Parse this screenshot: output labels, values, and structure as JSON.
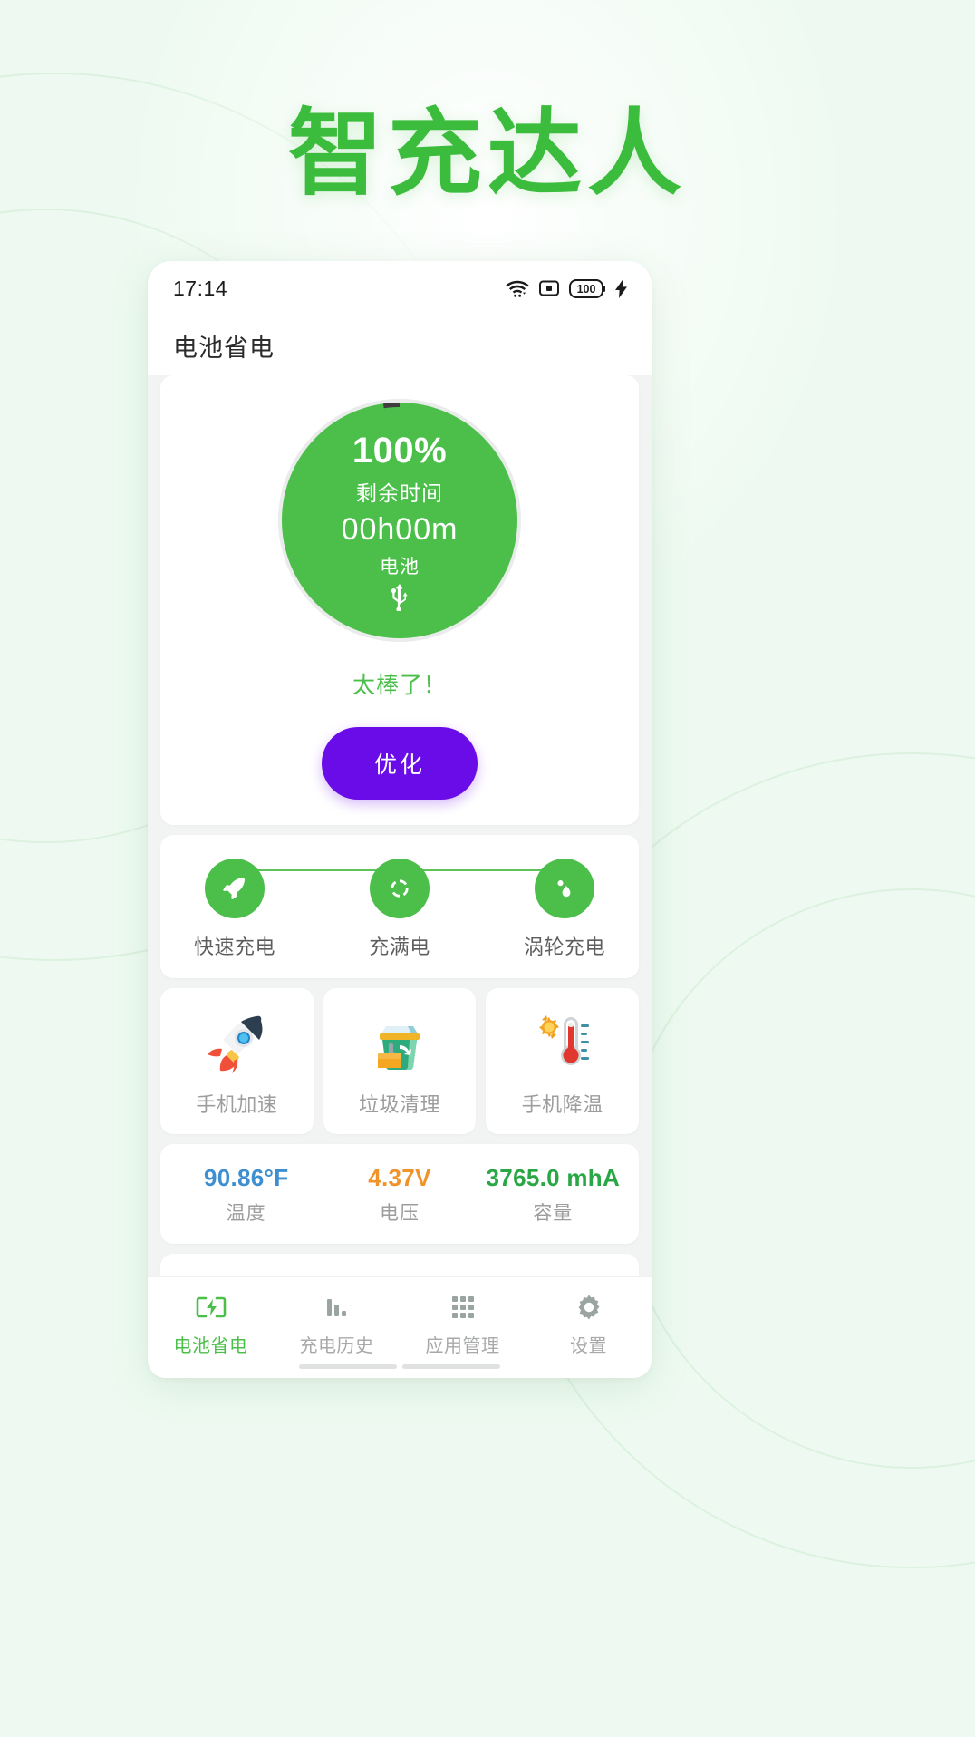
{
  "brand": {
    "title": "智充达人",
    "color": "#3cbc3c"
  },
  "statusbar": {
    "time": "17:14",
    "battery_text": "100",
    "icons": [
      "wifi-icon",
      "cast-icon",
      "battery-icon",
      "charging-bolt-icon"
    ]
  },
  "header": {
    "title": "电池省电"
  },
  "battery": {
    "percent": "100%",
    "remaining_label": "剩余时间",
    "remaining_time": "00h00m",
    "source_label": "电池",
    "source_icon": "usb-icon",
    "status_text": "太棒了！",
    "optimize_label": "优化",
    "ring_percent": 100,
    "fill_color": "#4cbf4a",
    "optimize_color": "#6a0ce8",
    "status_color": "#4cbf4a"
  },
  "steps": [
    {
      "label": "快速充电",
      "icon": "rocket-icon"
    },
    {
      "label": "充满电",
      "icon": "refresh-icon"
    },
    {
      "label": "涡轮充电",
      "icon": "water-drop-icon"
    }
  ],
  "tools": [
    {
      "label": "手机加速",
      "icon": "rocket-color-icon"
    },
    {
      "label": "垃圾清理",
      "icon": "trash-recycle-icon"
    },
    {
      "label": "手机降温",
      "icon": "thermometer-sun-icon"
    }
  ],
  "stats": [
    {
      "value": "90.86°F",
      "label": "温度",
      "color": "#3f8fd0"
    },
    {
      "value": "4.37V",
      "label": "电压",
      "color": "#f0932b"
    },
    {
      "value": "3765.0 mhA",
      "label": "容量",
      "color": "#29a745"
    }
  ],
  "nav": [
    {
      "label": "电池省电",
      "icon": "battery-charge-icon",
      "active": true
    },
    {
      "label": "充电历史",
      "icon": "bar-chart-icon",
      "active": false
    },
    {
      "label": "应用管理",
      "icon": "grid-apps-icon",
      "active": false
    },
    {
      "label": "设置",
      "icon": "gear-icon",
      "active": false
    }
  ]
}
